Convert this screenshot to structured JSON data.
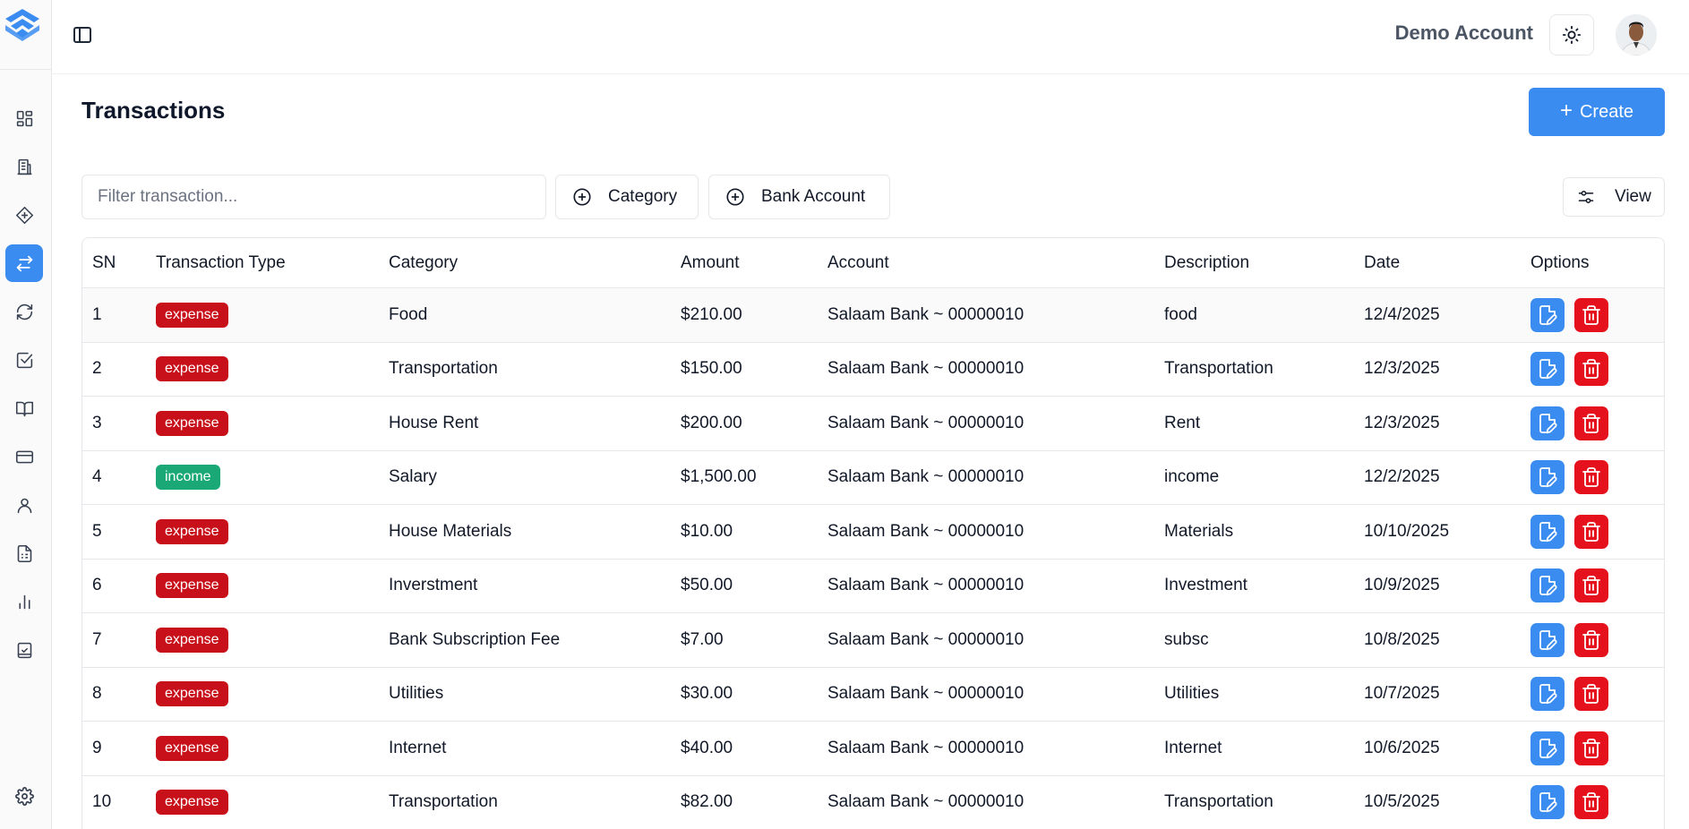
{
  "app": {
    "account_name": "Demo Account",
    "brand_color": "#3b8cf0"
  },
  "sidebar": {
    "items": [
      {
        "icon": "dashboard-icon",
        "active": false
      },
      {
        "icon": "building-icon",
        "active": false
      },
      {
        "icon": "category-icon",
        "active": false
      },
      {
        "icon": "transactions-icon",
        "active": true
      },
      {
        "icon": "refresh-icon",
        "active": false
      },
      {
        "icon": "checkbox-icon",
        "active": false
      },
      {
        "icon": "book-icon",
        "active": false
      },
      {
        "icon": "credit-card-icon",
        "active": false
      },
      {
        "icon": "user-icon",
        "active": false
      },
      {
        "icon": "report-icon",
        "active": false
      },
      {
        "icon": "chart-icon",
        "active": false
      },
      {
        "icon": "clipboard-check-icon",
        "active": false
      }
    ],
    "footer_icon": "settings-icon"
  },
  "page": {
    "title": "Transactions",
    "create_label": "Create"
  },
  "filters": {
    "search_placeholder": "Filter transaction...",
    "category_label": "Category",
    "bank_account_label": "Bank Account",
    "view_label": "View"
  },
  "table": {
    "columns": [
      "SN",
      "Transaction Type",
      "Category",
      "Amount",
      "Account",
      "Description",
      "Date",
      "Options"
    ],
    "rows": [
      {
        "sn": "1",
        "type": "expense",
        "category": "Food",
        "amount": "$210.00",
        "account": "Salaam Bank ~ 00000010",
        "description": "food",
        "date": "12/4/2025"
      },
      {
        "sn": "2",
        "type": "expense",
        "category": "Transportation",
        "amount": "$150.00",
        "account": "Salaam Bank ~ 00000010",
        "description": "Transportation",
        "date": "12/3/2025"
      },
      {
        "sn": "3",
        "type": "expense",
        "category": "House Rent",
        "amount": "$200.00",
        "account": "Salaam Bank ~ 00000010",
        "description": "Rent",
        "date": "12/3/2025"
      },
      {
        "sn": "4",
        "type": "income",
        "category": "Salary",
        "amount": "$1,500.00",
        "account": "Salaam Bank ~ 00000010",
        "description": "income",
        "date": "12/2/2025"
      },
      {
        "sn": "5",
        "type": "expense",
        "category": "House Materials",
        "amount": "$10.00",
        "account": "Salaam Bank ~ 00000010",
        "description": "Materials",
        "date": "10/10/2025"
      },
      {
        "sn": "6",
        "type": "expense",
        "category": "Inverstment",
        "amount": "$50.00",
        "account": "Salaam Bank ~ 00000010",
        "description": "Investment",
        "date": "10/9/2025"
      },
      {
        "sn": "7",
        "type": "expense",
        "category": "Bank Subscription Fee",
        "amount": "$7.00",
        "account": "Salaam Bank ~ 00000010",
        "description": "subsc",
        "date": "10/8/2025"
      },
      {
        "sn": "8",
        "type": "expense",
        "category": "Utilities",
        "amount": "$30.00",
        "account": "Salaam Bank ~ 00000010",
        "description": "Utilities",
        "date": "10/7/2025"
      },
      {
        "sn": "9",
        "type": "expense",
        "category": "Internet",
        "amount": "$40.00",
        "account": "Salaam Bank ~ 00000010",
        "description": "Internet",
        "date": "10/6/2025"
      },
      {
        "sn": "10",
        "type": "expense",
        "category": "Transportation",
        "amount": "$82.00",
        "account": "Salaam Bank ~ 00000010",
        "description": "Transportation",
        "date": "10/5/2025"
      }
    ]
  },
  "colors": {
    "expense_badge": "#c8101a",
    "income_badge": "#1aa877",
    "edit_button": "#3b8cf0",
    "delete_button": "#e5121d"
  }
}
